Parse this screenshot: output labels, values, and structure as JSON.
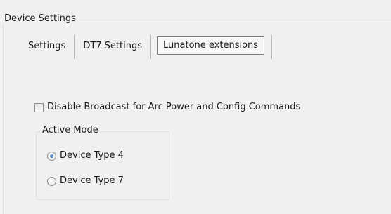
{
  "device_settings": {
    "title": "Device Settings",
    "tabs": [
      {
        "label": "Settings",
        "active": false
      },
      {
        "label": "DT7 Settings",
        "active": false
      },
      {
        "label": "Lunatone extensions",
        "active": true
      }
    ],
    "disable_broadcast": {
      "label": "Disable Broadcast for Arc Power and Config Commands",
      "checked": false
    },
    "active_mode": {
      "title": "Active Mode",
      "options": [
        {
          "label": "Device Type 4",
          "selected": true
        },
        {
          "label": "Device Type 7",
          "selected": false
        }
      ]
    }
  }
}
